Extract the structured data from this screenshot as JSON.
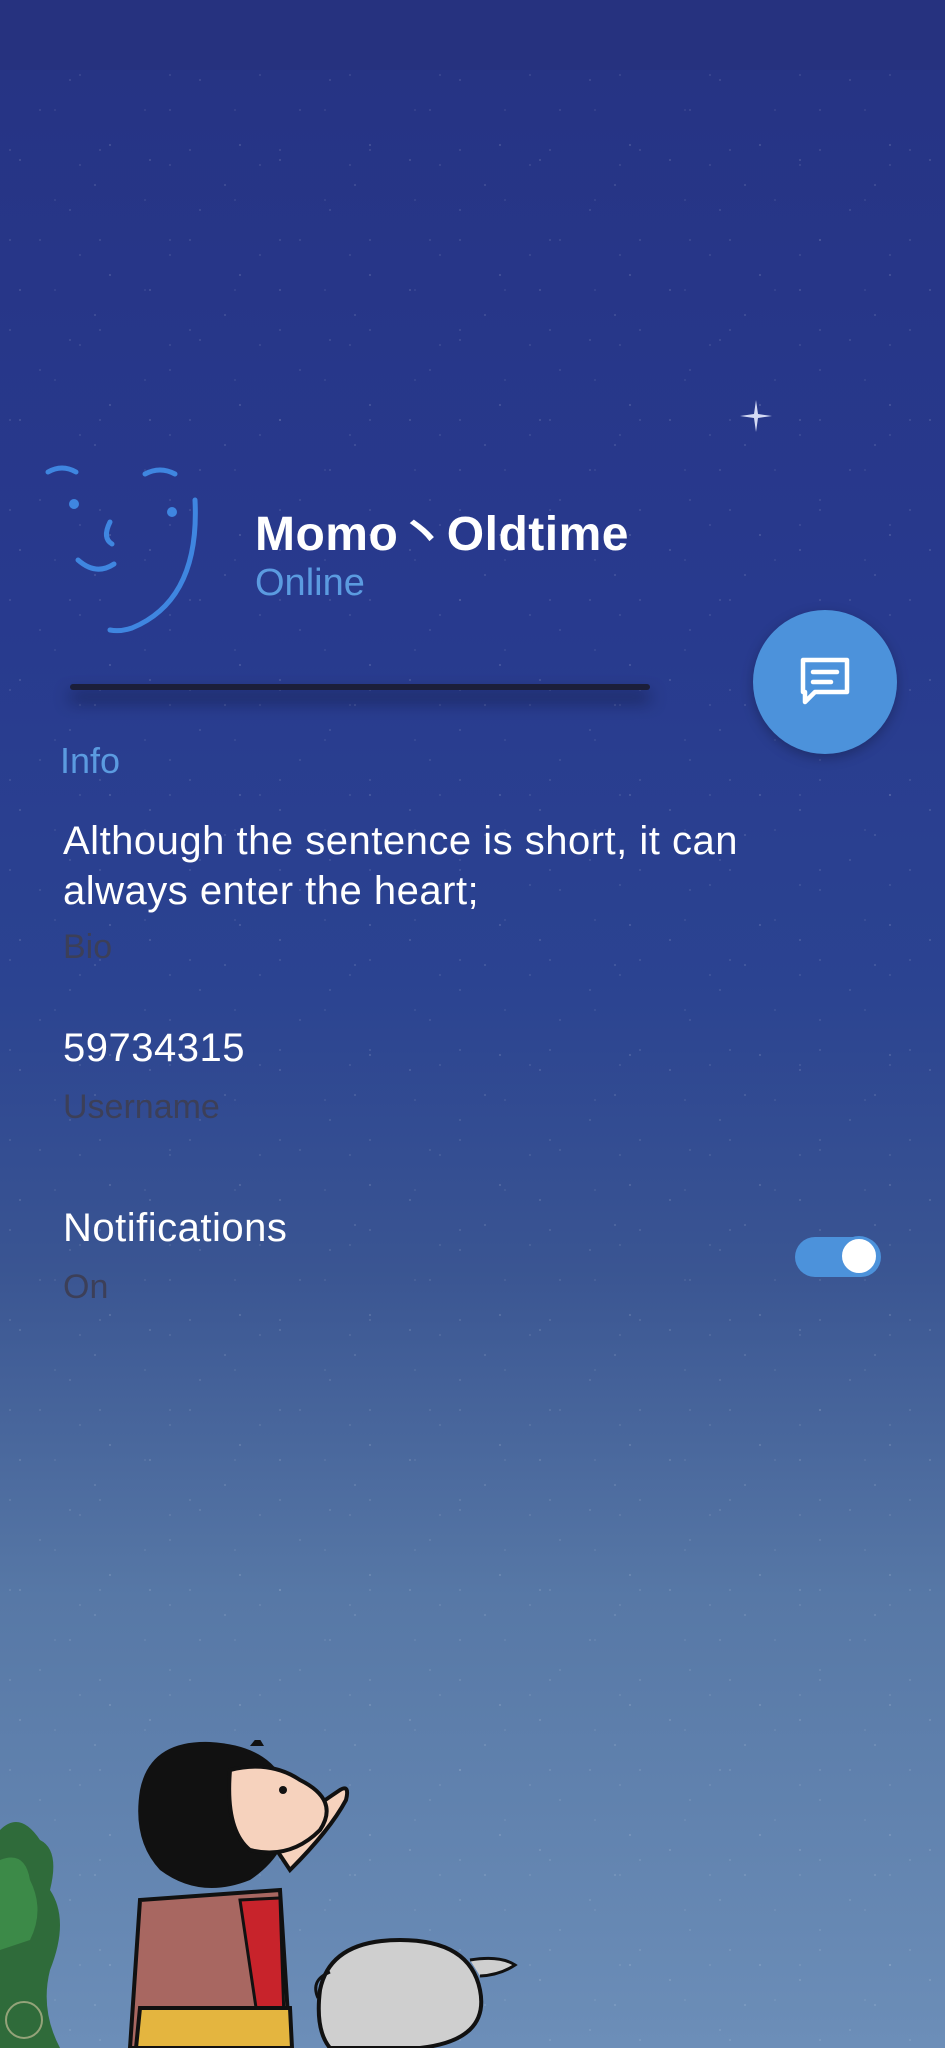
{
  "profile": {
    "name": "Momo丶Oldtime",
    "status": "Online"
  },
  "fab": {
    "icon": "message-icon"
  },
  "info": {
    "section_title": "Info",
    "bio": {
      "value": "Although the sentence is short, it can always enter the heart;",
      "label": "Bio"
    },
    "username": {
      "value": "59734315",
      "label": "Username"
    },
    "notifications": {
      "title": "Notifications",
      "state": "On",
      "enabled": true
    }
  },
  "colors": {
    "accent": "#4c92db",
    "status": "#5b9be0",
    "background_top": "#263383",
    "background_bottom": "#6c8eb8",
    "secondary_text": "#3c3f58"
  }
}
